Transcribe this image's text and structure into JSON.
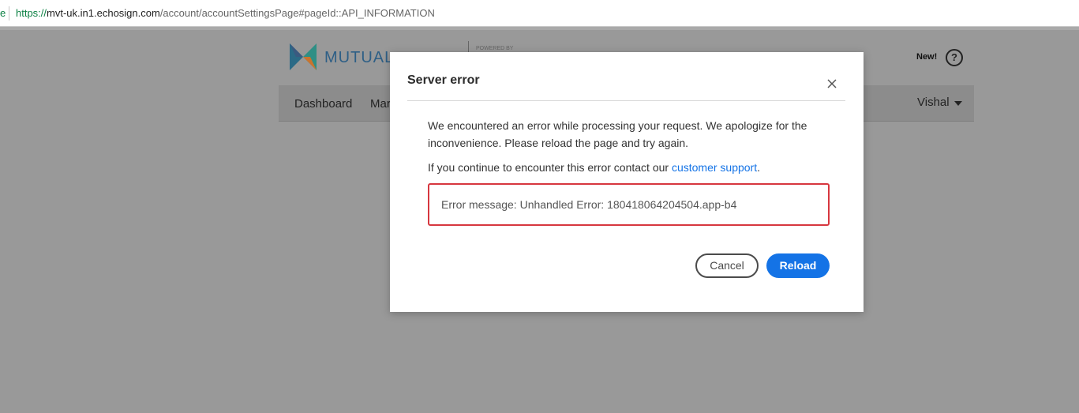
{
  "browser": {
    "url_scheme": "https://",
    "url_host": "mvt-uk.in1.echosign.com",
    "url_path": "/account/accountSettingsPage#pageId::API_INFORMATION",
    "secure_glyph": "e"
  },
  "app": {
    "brand": "MUTUAL",
    "powered_by": "POWERED BY",
    "new_label": "New!",
    "help_glyph": "?",
    "nav": {
      "items": [
        "Dashboard",
        "Mar"
      ],
      "user": "Vishal"
    }
  },
  "modal": {
    "title": "Server error",
    "message": "We encountered an error while processing your request. We apologize for the inconvenience. Please reload the page and try again.",
    "contact_prefix": "If you continue to encounter this error contact our ",
    "support_link": "customer support",
    "contact_suffix": ".",
    "error_message": "Error message: Unhandled Error: 180418064204504.app-b4",
    "cancel_label": "Cancel",
    "reload_label": "Reload"
  },
  "colors": {
    "accent": "#1473e6",
    "error_border": "#d7373f",
    "overlay": "#999999"
  }
}
